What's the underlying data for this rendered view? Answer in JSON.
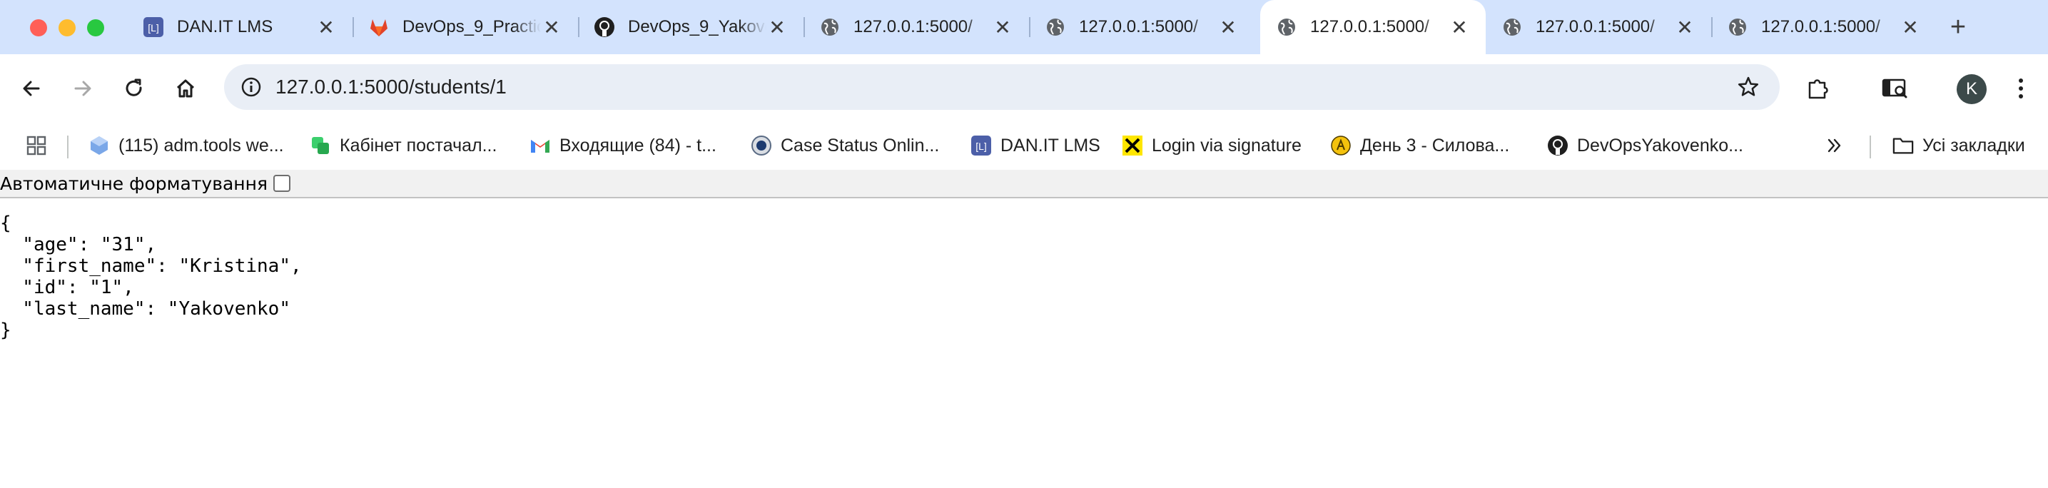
{
  "tabs": [
    {
      "title": "DAN.IT LMS",
      "icon": "lms-icon",
      "active": false
    },
    {
      "title": "DevOps_9_Practice",
      "icon": "gitlab-icon",
      "active": false
    },
    {
      "title": "DevOps_9_Yakovenko",
      "icon": "github-icon",
      "active": false
    },
    {
      "title": "127.0.0.1:5000/",
      "icon": "globe-icon",
      "active": false
    },
    {
      "title": "127.0.0.1:5000/",
      "icon": "globe-icon",
      "active": false
    },
    {
      "title": "127.0.0.1:5000/",
      "icon": "globe-icon",
      "active": true
    },
    {
      "title": "127.0.0.1:5000/",
      "icon": "globe-icon",
      "active": false
    },
    {
      "title": "127.0.0.1:5000/",
      "icon": "globe-icon",
      "active": false
    }
  ],
  "toolbar": {
    "url": "127.0.0.1:5000/students/1",
    "avatar_letter": "K"
  },
  "bookmarks": [
    {
      "label": "(115) adm.tools we...",
      "icon": "admtools-icon"
    },
    {
      "label": "Кабінет постачал...",
      "icon": "supplier-icon"
    },
    {
      "label": "Входящие (84) - t...",
      "icon": "gmail-icon"
    },
    {
      "label": "Case Status Onlin...",
      "icon": "uscis-icon"
    },
    {
      "label": "DAN.IT LMS",
      "icon": "lms-icon"
    },
    {
      "label": "Login via signature",
      "icon": "raiffeisen-icon"
    },
    {
      "label": "День 3 - Силова...",
      "icon": "fitness-icon"
    },
    {
      "label": "DevOpsYakovenko...",
      "icon": "github-icon"
    }
  ],
  "bookmarks_all_label": "Усі закладки",
  "pretty_print": {
    "label": "Автоматичне форматування",
    "checked": false
  },
  "json_body": "{\n  \"age\": \"31\",\n  \"first_name\": \"Kristina\",\n  \"id\": \"1\",\n  \"last_name\": \"Yakovenko\"\n}",
  "colors": {
    "tabstrip_bg": "#d3e3fd",
    "omnibox_bg": "#e9eef6",
    "accent": "#0b57d0"
  }
}
